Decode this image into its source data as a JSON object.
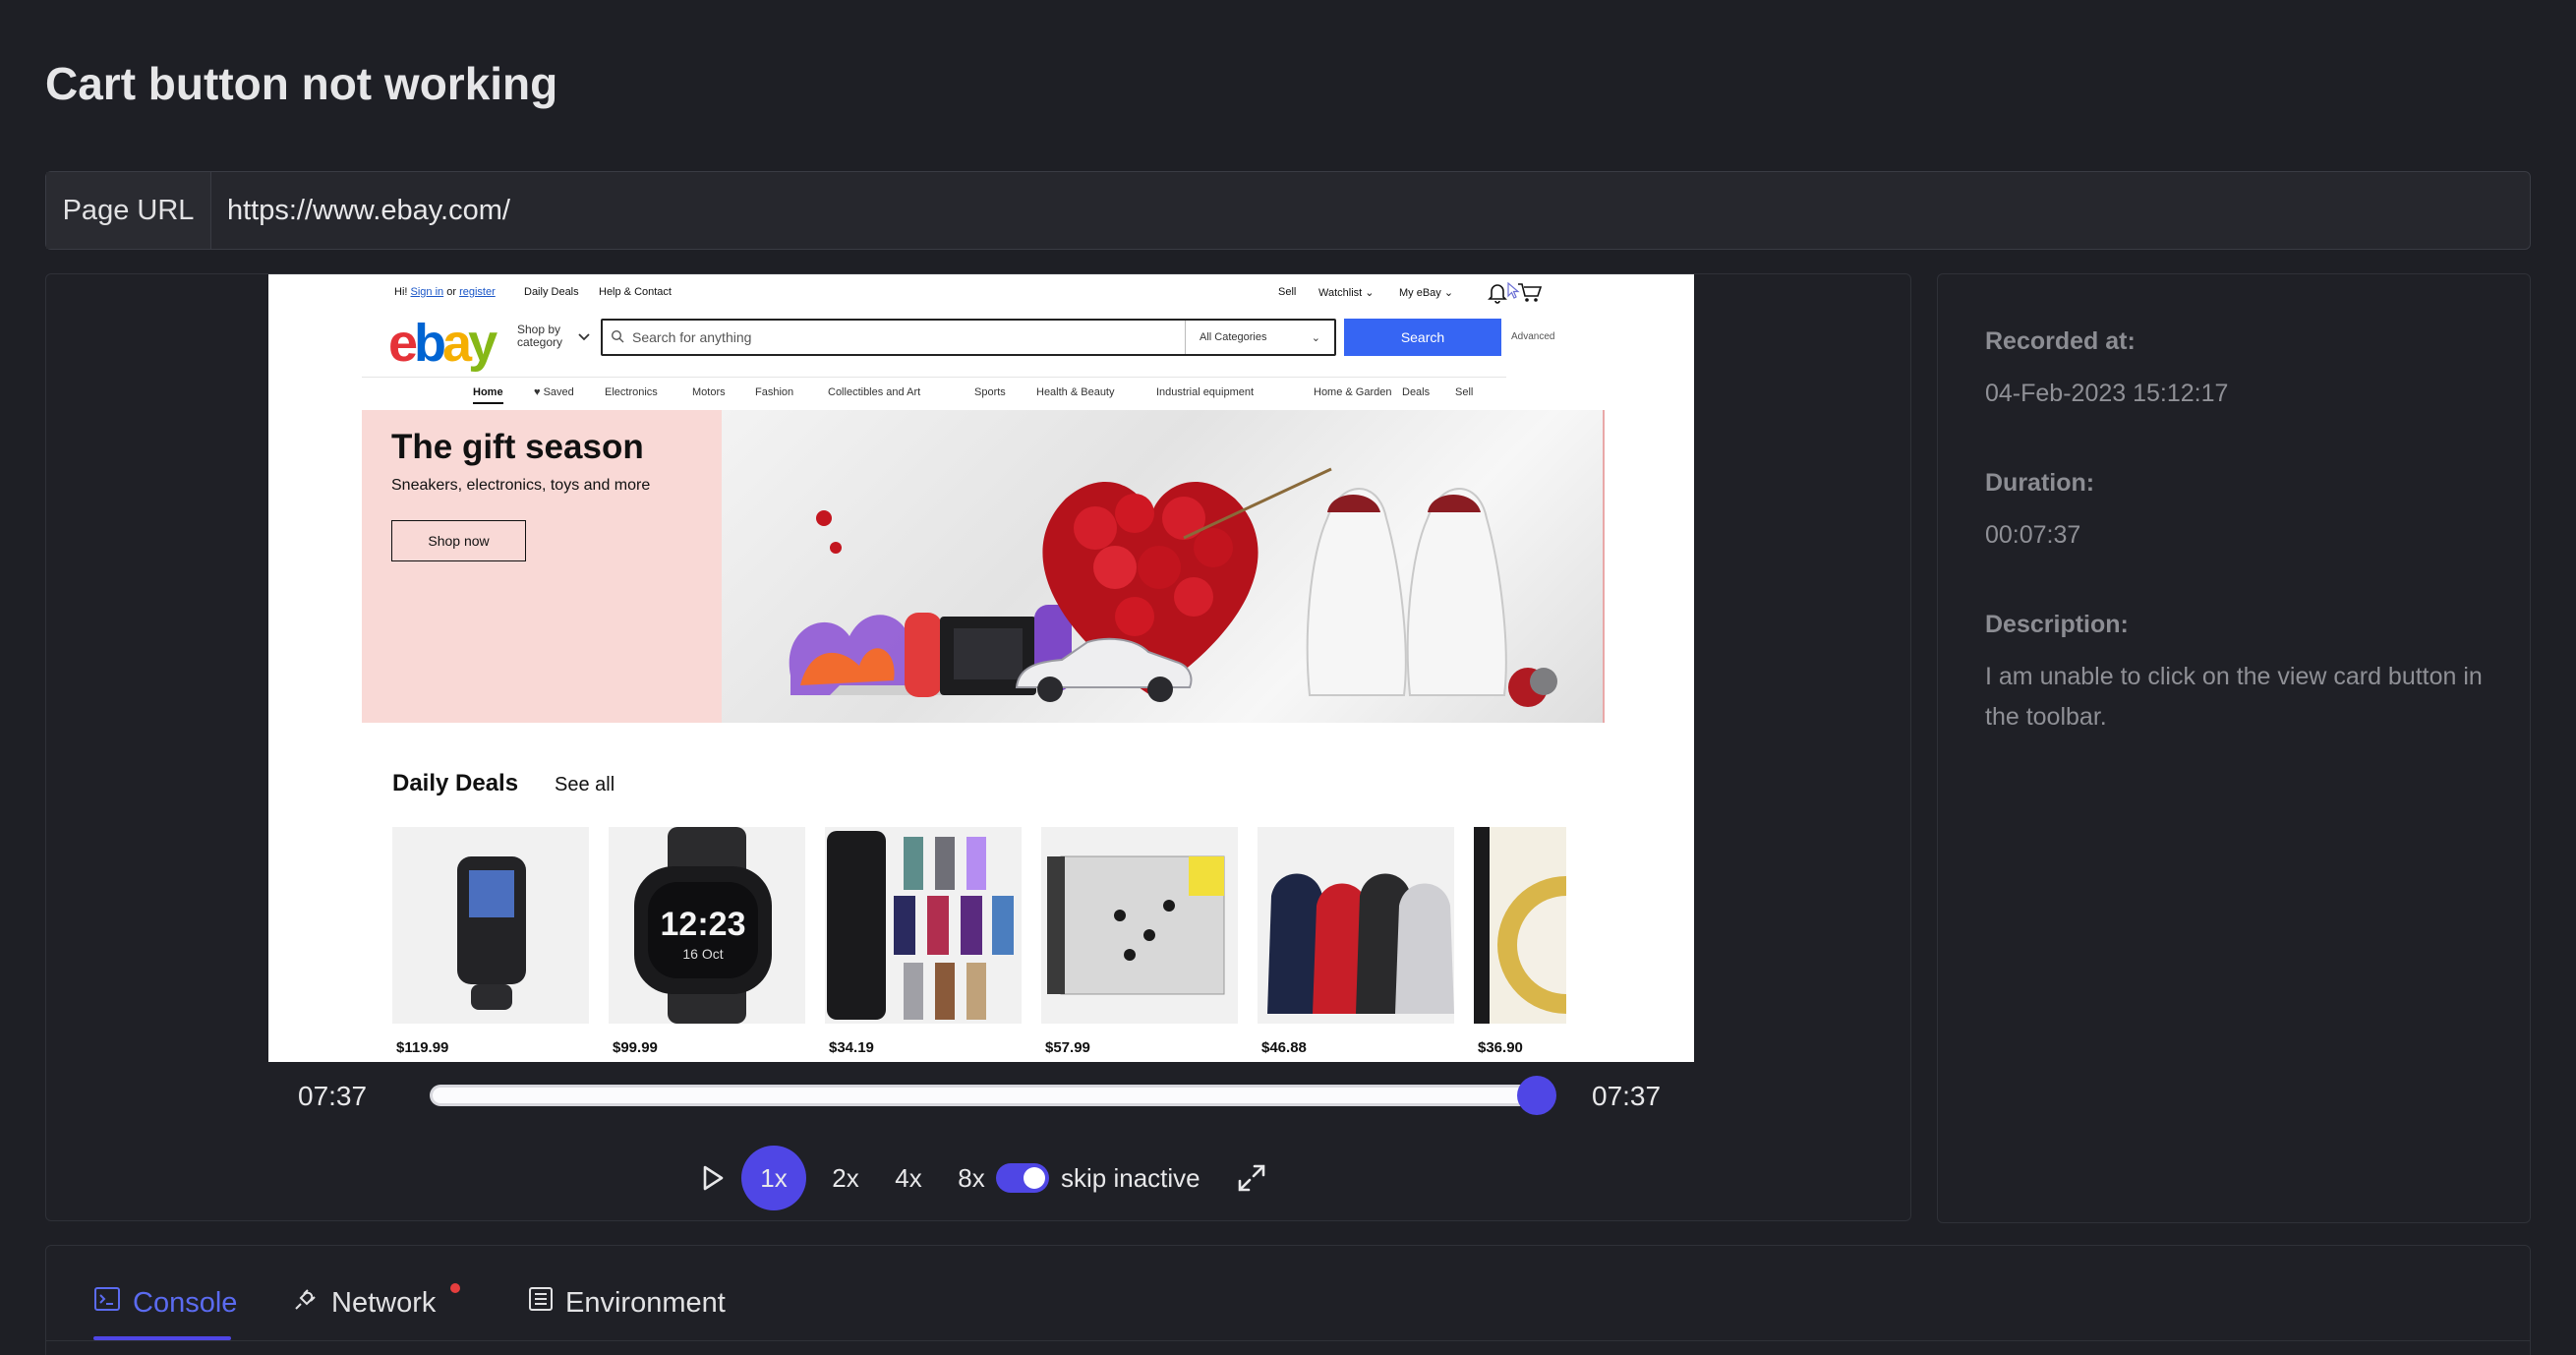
{
  "page": {
    "title": "Cart button not working"
  },
  "url_bar": {
    "label": "Page URL",
    "value": "https://www.ebay.com/"
  },
  "player": {
    "time_current": "07:37",
    "time_total": "07:37",
    "progress": 1.0,
    "speeds": [
      "1x",
      "2x",
      "4x",
      "8x"
    ],
    "active_speed": "1x",
    "skip_inactive_label": "skip inactive",
    "skip_inactive": true,
    "accent_color": "#4f46e5"
  },
  "meta": {
    "recorded_label": "Recorded at:",
    "recorded_value": "04-Feb-2023 15:12:17",
    "duration_label": "Duration:",
    "duration_value": "00:07:37",
    "description_label": "Description:",
    "description_value": "I am unable to click on the view card button in the toolbar."
  },
  "tabs": [
    {
      "label": "Console",
      "icon": "terminal-icon",
      "active": true
    },
    {
      "label": "Network",
      "icon": "plug-icon",
      "active": false,
      "indicator": true
    },
    {
      "label": "Environment",
      "icon": "list-icon",
      "active": false
    }
  ],
  "ebay": {
    "top": {
      "greeting": "Hi!",
      "sign_in": "Sign in",
      "or": "or",
      "register": "register",
      "daily_deals": "Daily Deals",
      "help": "Help & Contact",
      "sell": "Sell",
      "watchlist": "Watchlist",
      "my_ebay": "My eBay"
    },
    "logo": {
      "e": "e",
      "b": "b",
      "a": "a",
      "y": "y"
    },
    "shop_by_line1": "Shop by",
    "shop_by_line2": "category",
    "search_placeholder": "Search for anything",
    "category": "All Categories",
    "search_button": "Search",
    "advanced": "Advanced",
    "nav": [
      "Home",
      "Saved",
      "Electronics",
      "Motors",
      "Fashion",
      "Collectibles and Art",
      "Sports",
      "Health & Beauty",
      "Industrial equipment",
      "Home & Garden",
      "Deals",
      "Sell"
    ],
    "hero": {
      "title": "The gift season",
      "subtitle": "Sneakers, electronics, toys and more",
      "button": "Shop now"
    },
    "deals_title": "Daily Deals",
    "see_all": "See all",
    "prices": [
      "$119.99",
      "$99.99",
      "$34.19",
      "$57.99",
      "$46.88",
      "$36.90"
    ],
    "watch_time": "12:23",
    "watch_date": "16 Oct"
  }
}
